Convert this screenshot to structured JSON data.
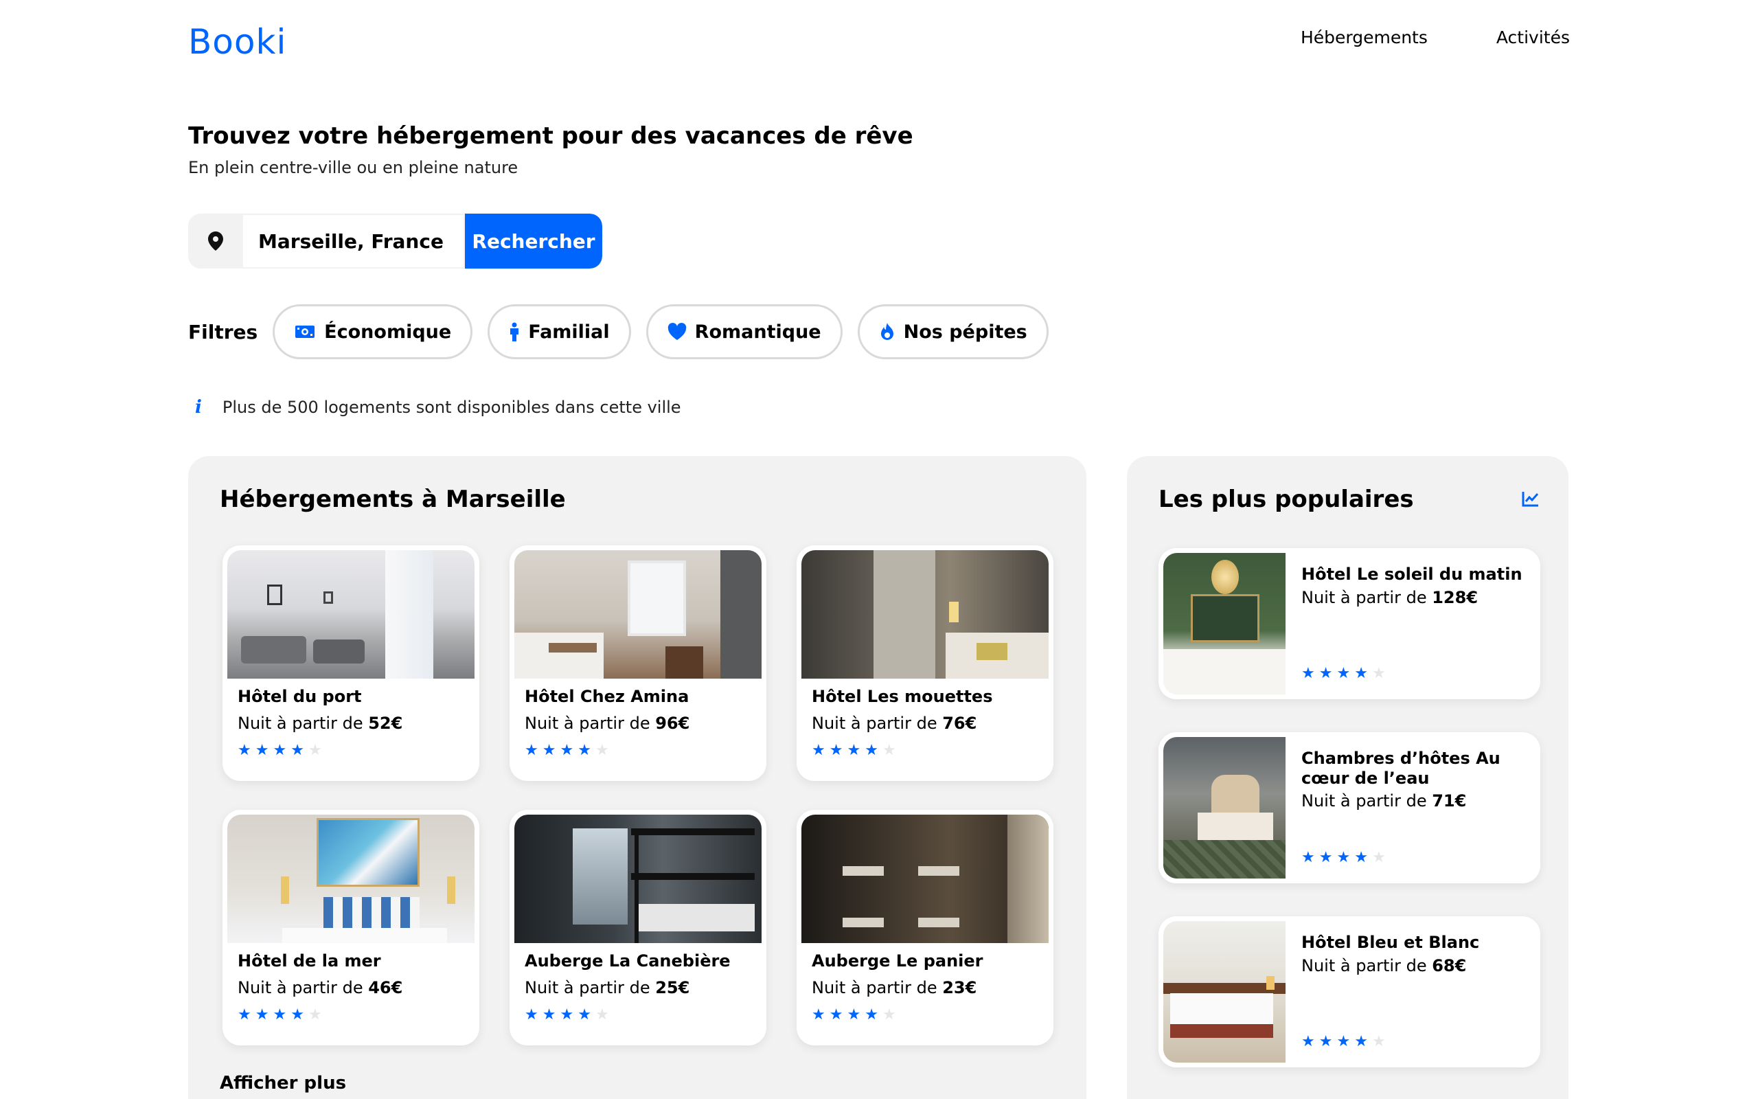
{
  "header": {
    "logo": "Booki",
    "nav": [
      "Hébergements",
      "Activités"
    ]
  },
  "hero": {
    "title": "Trouvez votre hébergement pour des vacances de rêve",
    "subtitle": "En plein centre-ville ou en pleine nature"
  },
  "search": {
    "value": "Marseille, France",
    "button_label": "Rechercher",
    "icon": "location-pin-icon"
  },
  "filters": {
    "label": "Filtres",
    "items": [
      {
        "label": "Économique",
        "icon": "money-icon"
      },
      {
        "label": "Familial",
        "icon": "child-icon"
      },
      {
        "label": "Romantique",
        "icon": "heart-icon"
      },
      {
        "label": "Nos pépites",
        "icon": "fire-icon"
      }
    ]
  },
  "info": {
    "icon": "info-icon",
    "text": "Plus de 500 logements sont disponibles dans cette ville"
  },
  "accommodations": {
    "title": "Hébergements à Marseille",
    "price_prefix": "Nuit à partir de ",
    "show_more": "Afficher plus",
    "items": [
      {
        "name": "Hôtel du port",
        "price": "52€",
        "rating": 4
      },
      {
        "name": "Hôtel Chez Amina",
        "price": "96€",
        "rating": 4
      },
      {
        "name": "Hôtel Les mouettes",
        "price": "76€",
        "rating": 4
      },
      {
        "name": "Hôtel de la mer",
        "price": "46€",
        "rating": 4
      },
      {
        "name": "Auberge La Canebière",
        "price": "25€",
        "rating": 4
      },
      {
        "name": "Auberge Le panier",
        "price": "23€",
        "rating": 4
      }
    ]
  },
  "popular": {
    "title": "Les plus populaires",
    "icon": "trend-chart-icon",
    "price_prefix": "Nuit à partir de ",
    "items": [
      {
        "name": "Hôtel Le soleil du matin",
        "price": "128€",
        "rating": 4
      },
      {
        "name": "Chambres d’hôtes Au cœur de l’eau",
        "price": "71€",
        "rating": 4
      },
      {
        "name": "Hôtel Bleu et Blanc",
        "price": "68€",
        "rating": 4
      }
    ]
  },
  "colors": {
    "accent": "#0065fc",
    "panel": "#f2f2f2"
  }
}
